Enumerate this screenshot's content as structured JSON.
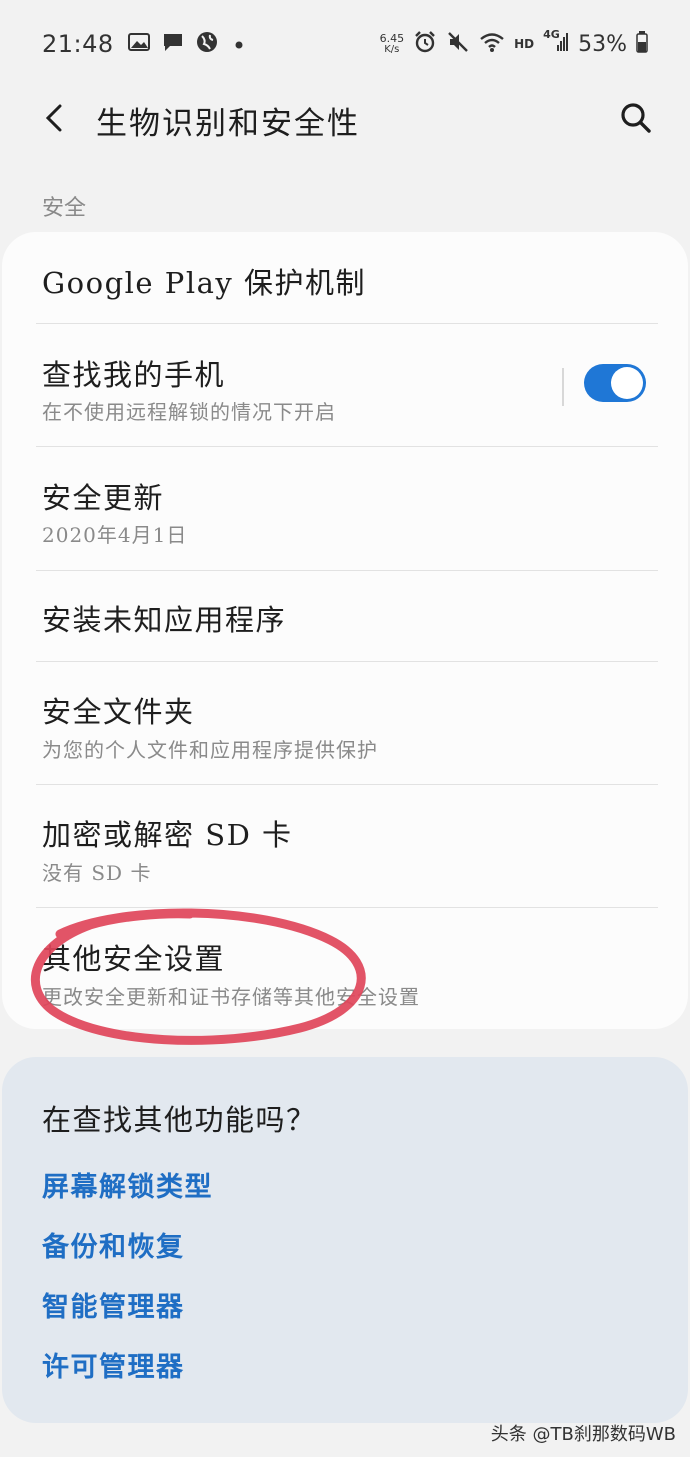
{
  "status_bar": {
    "time": "21:48",
    "speed_value": "6.45",
    "speed_unit": "K/s",
    "hd": "HD",
    "network": "4G",
    "battery": "53%"
  },
  "header": {
    "title": "生物识别和安全性"
  },
  "section": {
    "label": "安全"
  },
  "settings": [
    {
      "title": "Google Play 保护机制",
      "subtitle": ""
    },
    {
      "title": "查找我的手机",
      "subtitle": "在不使用远程解锁的情况下开启",
      "toggle_on": true
    },
    {
      "title": "安全更新",
      "subtitle": "2020年4月1日"
    },
    {
      "title": "安装未知应用程序",
      "subtitle": ""
    },
    {
      "title": "安全文件夹",
      "subtitle": "为您的个人文件和应用程序提供保护"
    },
    {
      "title": "加密或解密 SD 卡",
      "subtitle": "没有 SD 卡"
    },
    {
      "title": "其他安全设置",
      "subtitle": "更改安全更新和证书存储等其他安全设置"
    }
  ],
  "more": {
    "title": "在查找其他功能吗？",
    "links": [
      "屏幕解锁类型",
      "备份和恢复",
      "智能管理器",
      "许可管理器"
    ]
  },
  "colors": {
    "accent": "#1f77d6",
    "link": "#1f6ec4",
    "annotation": "#e0455a"
  },
  "watermark": "头条 @TB刹那数码WB"
}
